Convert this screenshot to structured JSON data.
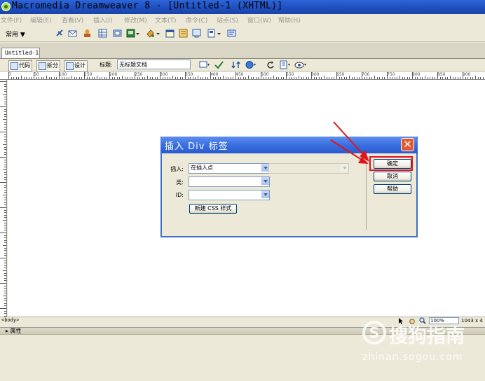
{
  "window": {
    "title": "Macromedia Dreamweaver 8 - [Untitled-1 (XHTML)]"
  },
  "menu": [
    "文件(F)",
    "编辑(E)",
    "查看(V)",
    "插入(I)",
    "修改(M)",
    "文本(T)",
    "命令(C)",
    "站点(S)",
    "窗口(W)",
    "帮助(H)"
  ],
  "insert_bar": {
    "category": "常用 ▼"
  },
  "document": {
    "tab_label": "Untitled-1",
    "view_buttons": [
      "代码",
      "拆分",
      "设计"
    ],
    "title_label": "标题:",
    "title_value": "无标题文档"
  },
  "ruler": {
    "labels": [
      "0",
      "50",
      "100",
      "150",
      "200",
      "250",
      "300",
      "350",
      "400",
      "450",
      "500",
      "550",
      "600",
      "650",
      "700",
      "750",
      "800",
      "850",
      "900"
    ]
  },
  "status_bar": {
    "tag": "<body>",
    "zoom": "100%",
    "size": "1043 x 4"
  },
  "properties_panel": {
    "label": "▸ 属性"
  },
  "dialog": {
    "title": "插入 Div 标签",
    "insert_label": "插入:",
    "insert_value": "在插入点",
    "class_label": "类:",
    "id_label": "ID:",
    "new_css_button": "新建 CSS 样式",
    "ok_button": "确定",
    "cancel_button": "取消",
    "help_button": "帮助",
    "close_glyph": "✕"
  },
  "watermark": {
    "brand": "搜狗指南",
    "url": "zhinan.sogou.com",
    "logo_glyph": "S"
  },
  "colors": {
    "titlebar": "#2358c8",
    "dialog_title": "#3a6fe0",
    "highlight": "#e0141a",
    "arrow": "#e0141a"
  }
}
